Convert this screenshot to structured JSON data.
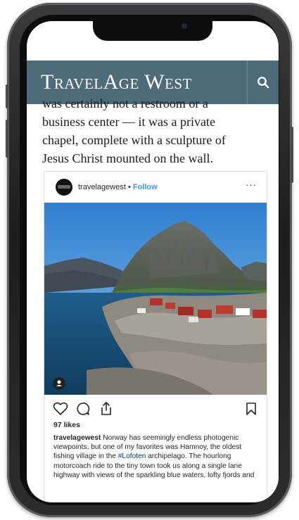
{
  "site": {
    "brand": "TravelAge West"
  },
  "article": {
    "lines": [
      "was certainly not a restroom or a",
      "business center — it was a private",
      "chapel, complete with a sculpture of",
      "Jesus Christ mounted on the wall."
    ]
  },
  "instagram": {
    "username": "travelagewest",
    "separator": "•",
    "follow_label": "Follow",
    "more_label": "···",
    "likes": "97 likes",
    "caption": {
      "username": "travelagewest",
      "text_before_tag": " Norway has seemingly endless photogenic viewpoints, but one of my favorites was Hamnoy, the oldest fishing village in the ",
      "hashtag": "#Lofoten",
      "text_after_tag": " archipelago. The hourlong motorcoach ride to the tiny town took us along a single lane highway with views of the sparkling blue waters, lofty fjords and"
    }
  },
  "icons": {
    "search": "search-icon",
    "like": "heart-icon",
    "comment": "comment-icon",
    "share": "share-icon",
    "save": "bookmark-icon",
    "tag": "person-icon"
  },
  "colors": {
    "header": "#4d6b7a",
    "follow": "#3897f0"
  }
}
